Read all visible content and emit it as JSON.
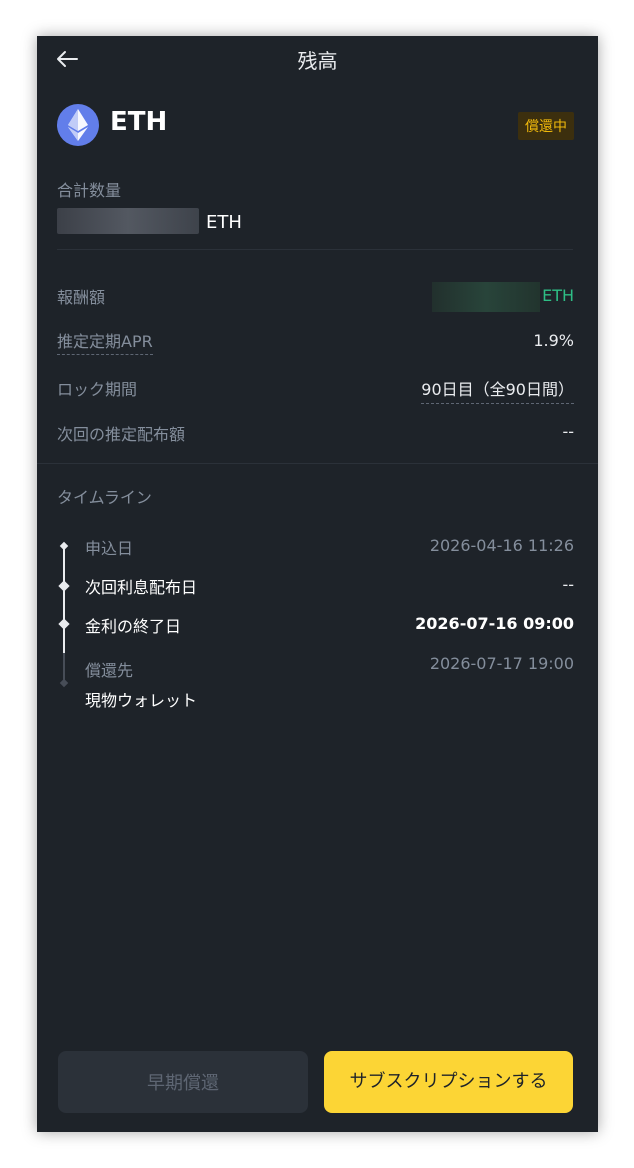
{
  "header": {
    "back_icon": "arrow-left-icon",
    "title": "残高"
  },
  "asset": {
    "symbol": "ETH",
    "status": "償還中"
  },
  "total": {
    "label": "合計数量",
    "unit": "ETH"
  },
  "details": {
    "reward_label": "報酬額",
    "reward_unit": "ETH",
    "apr_label": "推定定期APR",
    "apr_value": "1.9%",
    "lock_label": "ロック期間",
    "lock_value": "90日目（全90日間）",
    "next_dist_label": "次回の推定配布額",
    "next_dist_value": "--"
  },
  "timeline": {
    "title": "タイムライン",
    "items": [
      {
        "label": "申込日",
        "date": "2026-04-16 11:26"
      },
      {
        "label": "次回利息配布日",
        "date": "--"
      },
      {
        "label": "金利の終了日",
        "date": "2026-07-16 09:00"
      },
      {
        "label": "償還先",
        "date": "2026-07-17 19:00",
        "sub": "現物ウォレット"
      }
    ]
  },
  "actions": {
    "early_redeem": "早期償還",
    "subscribe": "サブスクリプションする"
  },
  "colors": {
    "background": "#1e2329",
    "accent": "#fcd535",
    "positive": "#2ebd85",
    "muted": "#848e9c"
  }
}
